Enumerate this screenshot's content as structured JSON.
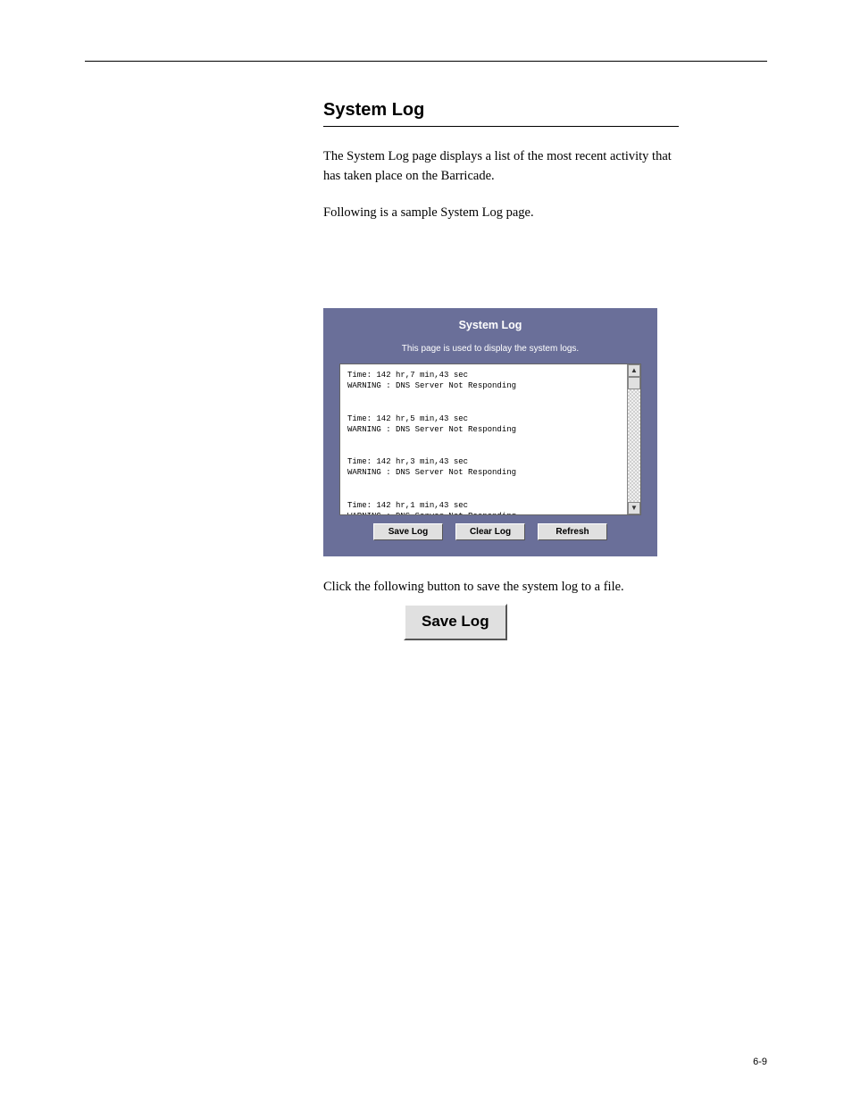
{
  "header": {
    "page_number": "6-9"
  },
  "section": {
    "title": "System Log",
    "intro": "The System Log page displays a list of the most recent activity that has taken place on the Barricade.",
    "after_figure": "Following is a sample System Log page.",
    "save_instruction_pre": "Click the following button to save the system log to a file.",
    "save_button_label": "Save Log"
  },
  "panel": {
    "title": "System Log",
    "description": "This page is used to display the system logs.",
    "logs": [
      "Time: 142 hr,7 min,43 sec",
      "WARNING : DNS Server Not Responding",
      "",
      "",
      "Time: 142 hr,5 min,43 sec",
      "WARNING : DNS Server Not Responding",
      "",
      "",
      "Time: 142 hr,3 min,43 sec",
      "WARNING : DNS Server Not Responding",
      "",
      "",
      "Time: 142 hr,1 min,43 sec",
      "WARNING : DNS Server Not Responding"
    ],
    "buttons": {
      "save": "Save Log",
      "clear": "Clear Log",
      "refresh": "Refresh"
    }
  }
}
